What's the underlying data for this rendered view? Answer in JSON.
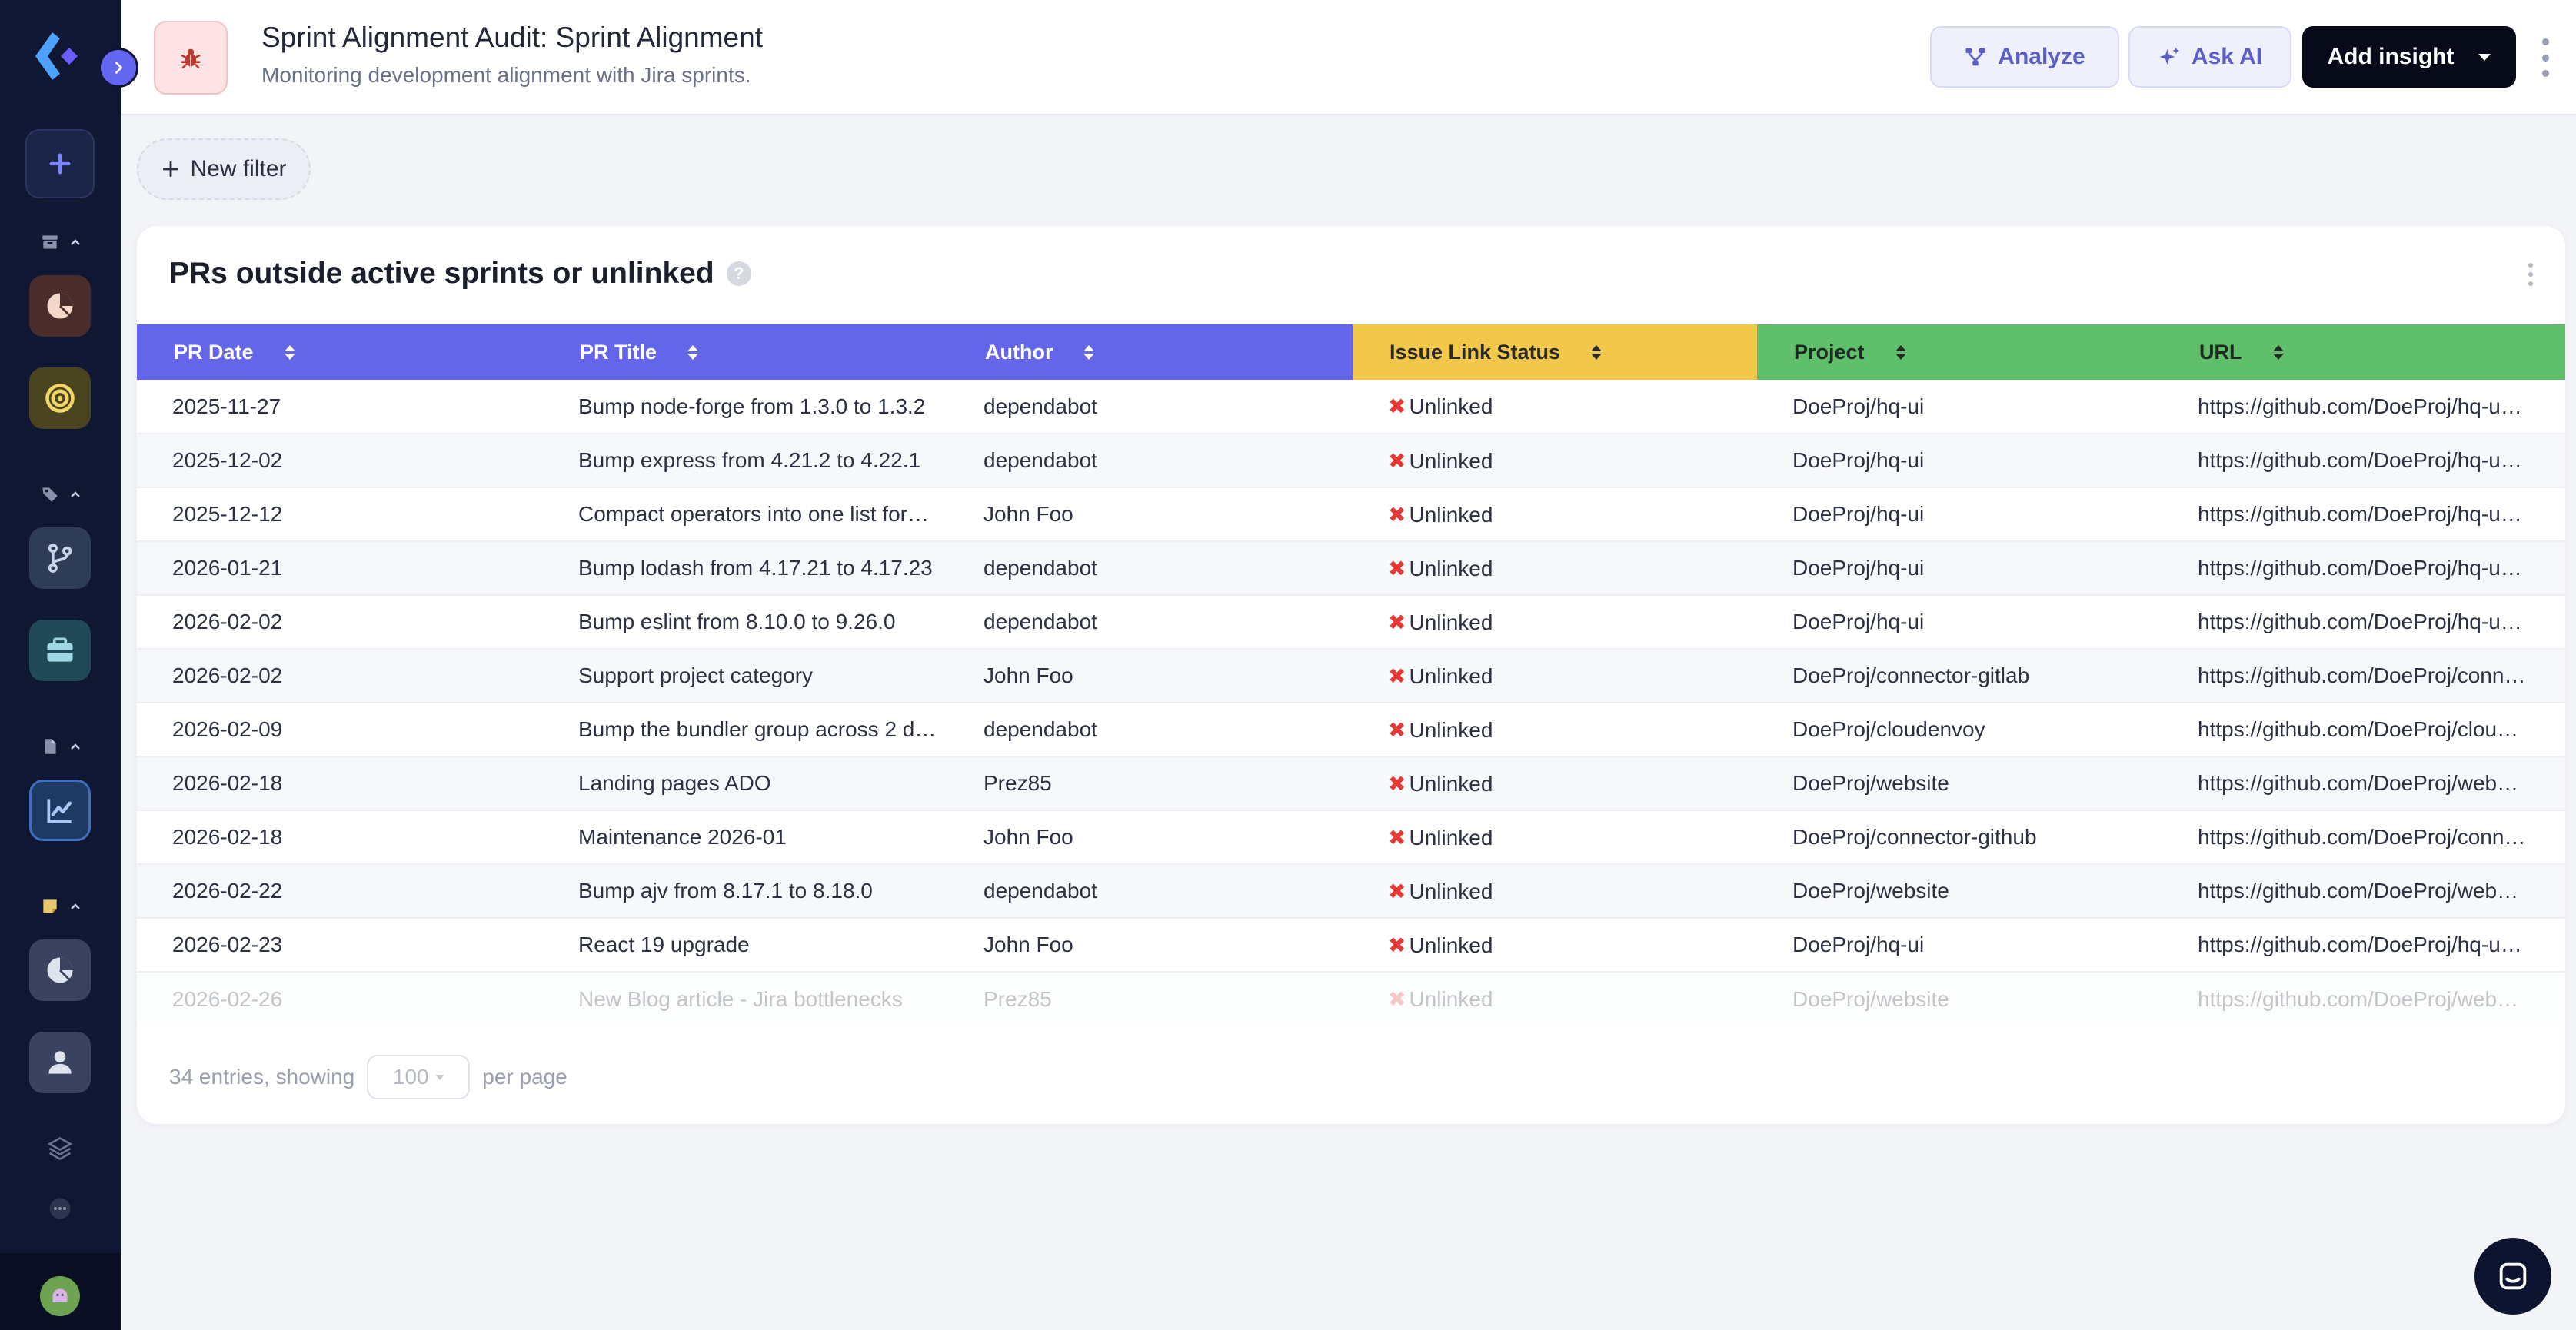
{
  "header": {
    "title": "Sprint Alignment Audit: Sprint Alignment",
    "subtitle": "Monitoring development alignment with Jira sprints.",
    "analyze_label": "Analyze",
    "ask_ai_label": "Ask AI",
    "add_insight_label": "Add insight"
  },
  "filter": {
    "new_filter_label": "New filter"
  },
  "card": {
    "title": "PRs outside active sprints or unlinked",
    "help": "?"
  },
  "table": {
    "columns": [
      "PR Date",
      "PR Title",
      "Author",
      "Issue Link Status",
      "Project",
      "URL"
    ],
    "rows": [
      [
        "2025-11-27",
        "Bump node-forge from 1.3.0 to 1.3.2",
        "dependabot",
        "Unlinked",
        "DoeProj/hq-ui",
        "https://github.com/DoeProj/hq-u…"
      ],
      [
        "2025-12-02",
        "Bump express from 4.21.2 to 4.22.1",
        "dependabot",
        "Unlinked",
        "DoeProj/hq-ui",
        "https://github.com/DoeProj/hq-u…"
      ],
      [
        "2025-12-12",
        "Compact operators into one list for…",
        "John Foo",
        "Unlinked",
        "DoeProj/hq-ui",
        "https://github.com/DoeProj/hq-u…"
      ],
      [
        "2026-01-21",
        "Bump lodash from 4.17.21 to 4.17.23",
        "dependabot",
        "Unlinked",
        "DoeProj/hq-ui",
        "https://github.com/DoeProj/hq-u…"
      ],
      [
        "2026-02-02",
        "Bump eslint from 8.10.0 to 9.26.0",
        "dependabot",
        "Unlinked",
        "DoeProj/hq-ui",
        "https://github.com/DoeProj/hq-u…"
      ],
      [
        "2026-02-02",
        "Support project category",
        "John Foo",
        "Unlinked",
        "DoeProj/connector-gitlab",
        "https://github.com/DoeProj/conn…"
      ],
      [
        "2026-02-09",
        "Bump the bundler group across 2 d…",
        "dependabot",
        "Unlinked",
        "DoeProj/cloudenvoy",
        "https://github.com/DoeProj/clou…"
      ],
      [
        "2026-02-18",
        "Landing pages ADO",
        "Prez85",
        "Unlinked",
        "DoeProj/website",
        "https://github.com/DoeProj/web…"
      ],
      [
        "2026-02-18",
        "Maintenance 2026-01",
        "John Foo",
        "Unlinked",
        "DoeProj/connector-github",
        "https://github.com/DoeProj/conn…"
      ],
      [
        "2026-02-22",
        "Bump ajv from 8.17.1 to 8.18.0",
        "dependabot",
        "Unlinked",
        "DoeProj/website",
        "https://github.com/DoeProj/web…"
      ],
      [
        "2026-02-23",
        "React 19 upgrade",
        "John Foo",
        "Unlinked",
        "DoeProj/hq-ui",
        "https://github.com/DoeProj/hq-u…"
      ],
      [
        "2026-02-26",
        "New Blog article - Jira bottlenecks",
        "Prez85",
        "Unlinked",
        "DoeProj/website",
        "https://github.com/DoeProj/web…"
      ]
    ]
  },
  "pager": {
    "entries_text": "34 entries, showing",
    "per_page_value": "100",
    "per_page_suffix": "per page"
  },
  "colors": {
    "header_blue": "#6366e8",
    "header_yellow": "#f3c84a",
    "header_green": "#5fbf6b",
    "sidebar_bg": "#0f1733",
    "status_red": "#e53935"
  },
  "icons": {
    "sidebar": [
      "logo-icon",
      "chevron-right-icon",
      "plus-icon",
      "archive-icon",
      "pie-chart-icon",
      "target-icon",
      "tag-icon",
      "git-branch-icon",
      "briefcase-icon",
      "file-icon",
      "line-chart-icon",
      "note-icon",
      "pie-chart-icon",
      "user-icon",
      "layers-icon",
      "chat-bubble-icon",
      "avatar-icon"
    ],
    "header": [
      "bug-icon",
      "analyze-icon",
      "sparkle-icon",
      "caret-down-icon",
      "kebab-icon"
    ]
  }
}
